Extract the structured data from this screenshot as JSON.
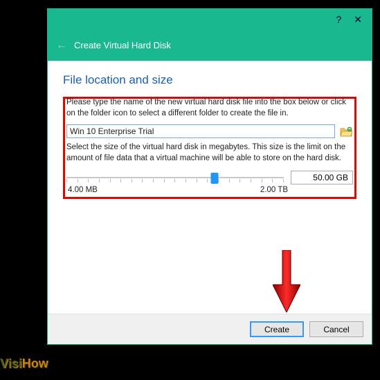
{
  "sys": {
    "help": "?",
    "close": "✕"
  },
  "header": {
    "back": "←",
    "title": "Create Virtual Hard Disk"
  },
  "heading": "File location and size",
  "instr1": "Please type the name of the new virtual hard disk file into the box below or click on the folder icon to select a different folder to create the file in.",
  "file_value": "Win 10 Enterprise Trial",
  "instr2": "Select the size of the virtual hard disk in megabytes. This size is the limit on the amount of file data that a virtual machine will be able to store on the hard disk.",
  "size_value": "50.00 GB",
  "range_min": "4.00 MB",
  "range_max": "2.00 TB",
  "buttons": {
    "create": "Create",
    "cancel": "Cancel"
  },
  "watermark": {
    "a": "Visi",
    "b": "How"
  }
}
